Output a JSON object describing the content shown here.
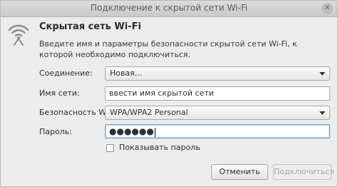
{
  "window": {
    "title": "Подключение к скрытой сети Wi-Fi",
    "close_glyph": "✕"
  },
  "dialog": {
    "icon": "wifi-icon",
    "heading": "Скрытая сеть Wi-Fi",
    "description": "Введите имя и параметры безопасности скрытой сети Wi-Fi, к которой необходимо подключиться."
  },
  "form": {
    "connection_label": "Соединение:",
    "connection_value": "Новая...",
    "network_name_label": "Имя сети:",
    "network_name_value": "ввести имя скрытой сети",
    "security_label": "Безопасность Wi-Fi:",
    "security_value": "WPA/WPA2 Personal",
    "password_label": "Пароль:",
    "password_value": "●●●●●●",
    "show_password_label": "Показывать пароль",
    "show_password_checked": false
  },
  "buttons": {
    "cancel_label": "Отменить",
    "connect_label": "Подключиться"
  },
  "colors": {
    "window_bg": "#ececec",
    "titlebar_bg": "#d2d2d2",
    "focus": "#7aa2c9",
    "disabled_text": "#a9a9a9"
  }
}
